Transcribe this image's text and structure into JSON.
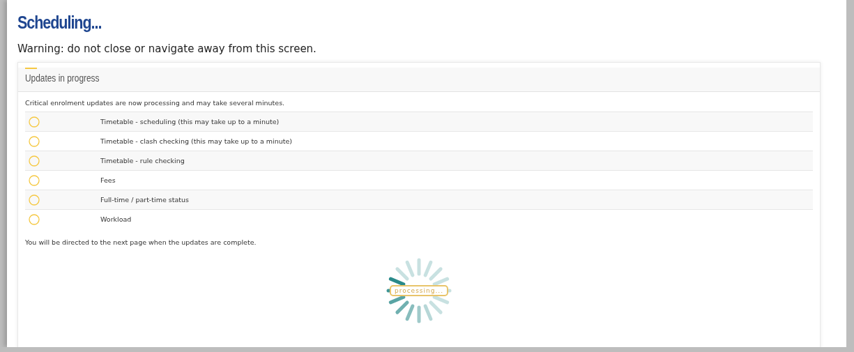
{
  "page": {
    "title": "Scheduling...",
    "warning": "Warning: do not close or navigate away from this screen."
  },
  "panel": {
    "title": "Updates in progress",
    "intro": "Critical enrolment updates are now processing and may take several minutes.",
    "tasks": [
      {
        "label": "Timetable - scheduling (this may take up to a minute)",
        "done": false
      },
      {
        "label": "Timetable - clash checking (this may take up to a minute)",
        "done": false
      },
      {
        "label": "Timetable - rule checking",
        "done": false
      },
      {
        "label": "Fees",
        "done": false
      },
      {
        "label": "Full-time / part-time status",
        "done": false
      },
      {
        "label": "Workload",
        "done": false
      }
    ],
    "footer": "You will be directed to the next page when the updates are complete.",
    "spinner_label": "processing..."
  }
}
